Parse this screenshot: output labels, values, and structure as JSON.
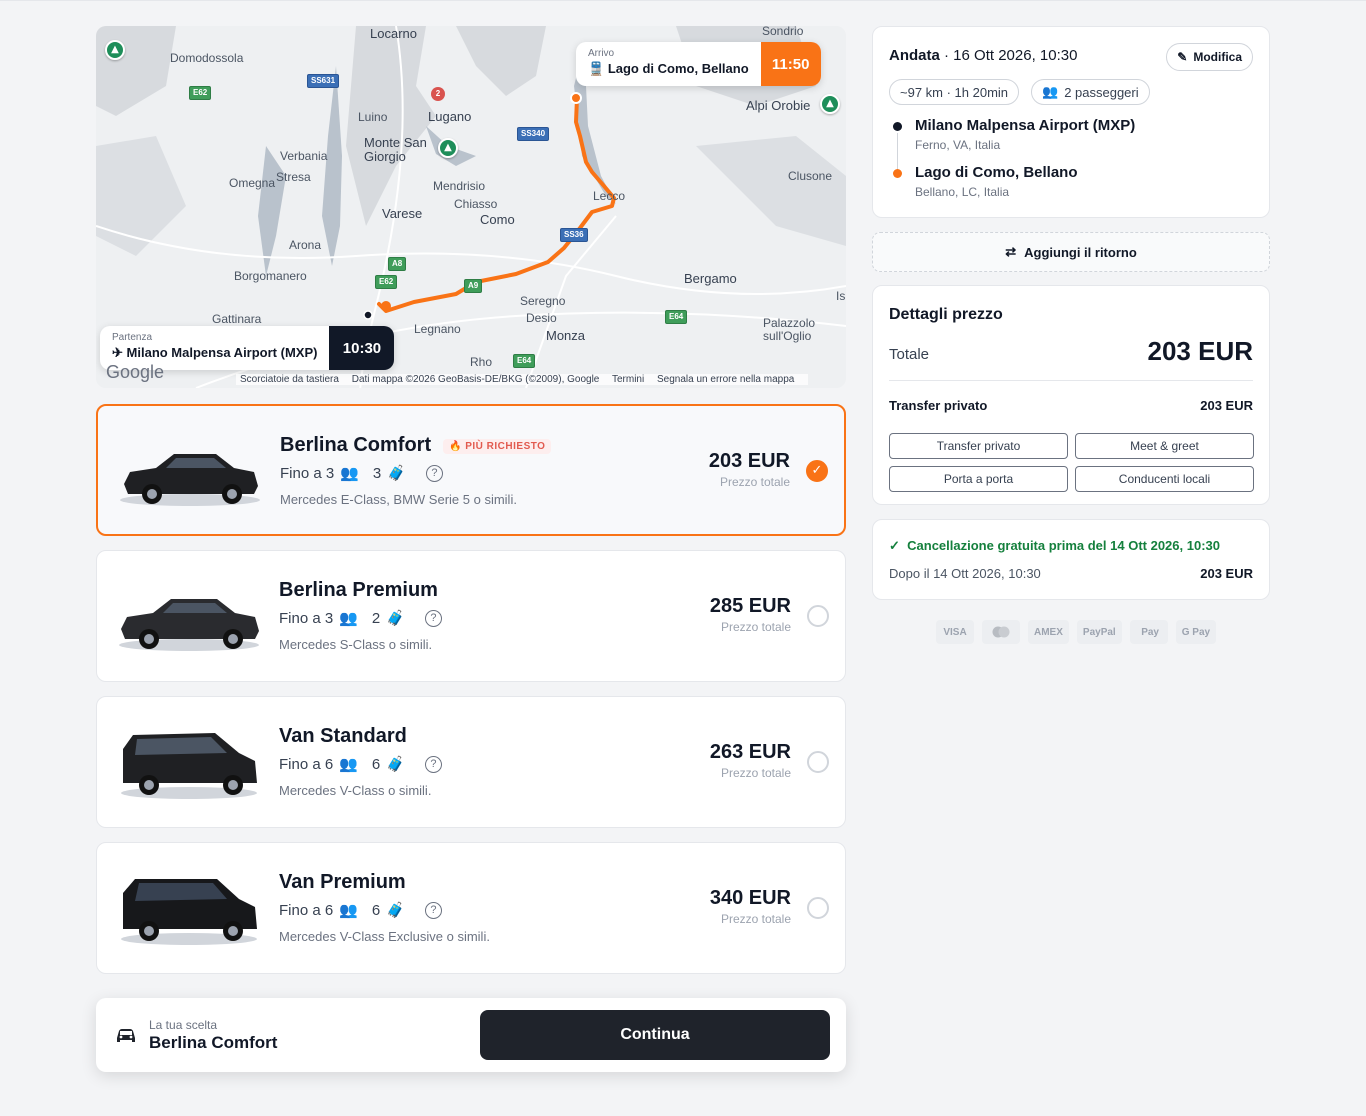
{
  "map": {
    "labels": [
      "Locarno",
      "Sondrio",
      "Domodossola",
      "Luino",
      "Lugano",
      "Alpi Orobie",
      "Monte San Giorgio",
      "Verbania",
      "Omegna",
      "Stresa",
      "Mendrisio",
      "Chiasso",
      "Varese",
      "Como",
      "Lecco",
      "Clusone",
      "Arona",
      "Borgomanero",
      "Gattinara",
      "Bergamo",
      "Seregno",
      "Desio",
      "Monza",
      "Legnano",
      "Rho",
      "Palazzolo sull'Oglio",
      "Is"
    ],
    "roads": [
      "SS631",
      "E62",
      "SS340",
      "SS36",
      "A8",
      "E62",
      "A9",
      "E64",
      "E64"
    ],
    "google": "Google",
    "footer": [
      "Scorciatoie da tastiera",
      "Dati mappa ©2026 GeoBasis-DE/BKG (©2009), Google",
      "Termini",
      "Segnala un errore nella mappa"
    ],
    "arrival": {
      "label": "Arrivo",
      "place": "Lago di Como, Bellano",
      "time": "11:50"
    },
    "departure": {
      "label": "Partenza",
      "place": "Milano Malpensa Airport (MXP)",
      "time": "10:30"
    }
  },
  "vehicles": [
    {
      "name": "Berlina Comfort",
      "badge": "PIÙ RICHIESTO",
      "up_to": "Fino a 3",
      "bags": "3",
      "models": "Mercedes E-Class, BMW Serie 5 o simili.",
      "price": "203 EUR",
      "price_label": "Prezzo totale"
    },
    {
      "name": "Berlina Premium",
      "up_to": "Fino a 3",
      "bags": "2",
      "models": "Mercedes S-Class o simili.",
      "price": "285 EUR",
      "price_label": "Prezzo totale"
    },
    {
      "name": "Van Standard",
      "up_to": "Fino a 6",
      "bags": "6",
      "models": "Mercedes V-Class o simili.",
      "price": "263 EUR",
      "price_label": "Prezzo totale"
    },
    {
      "name": "Van Premium",
      "up_to": "Fino a 6",
      "bags": "6",
      "models": "Mercedes V-Class Exclusive o simili.",
      "price": "340 EUR",
      "price_label": "Prezzo totale"
    }
  ],
  "selected_vehicle_index": 0,
  "choice": {
    "label": "La tua scelta",
    "value": "Berlina Comfort",
    "continue": "Continua"
  },
  "trip": {
    "direction": "Andata",
    "date": "· 16 Ott 2026, 10:30",
    "modify": "Modifica",
    "distance": "~97 km · 1h 20min",
    "passengers": "2 passeggeri",
    "from": {
      "name": "Milano Malpensa Airport (MXP)",
      "sub": "Ferno, VA, Italia"
    },
    "to": {
      "name": "Lago di Como, Bellano",
      "sub": "Bellano, LC, Italia"
    }
  },
  "return_btn": "Aggiungi il ritorno",
  "pricing": {
    "title": "Dettagli prezzo",
    "total_label": "Totale",
    "total": "203 EUR",
    "line_label": "Transfer privato",
    "line_value": "203 EUR",
    "features": [
      "Transfer privato",
      "Meet & greet",
      "Porta a porta",
      "Conducenti locali"
    ]
  },
  "cancellation": {
    "free": "Cancellazione gratuita prima del 14 Ott 2026, 10:30",
    "after_label": "Dopo il 14 Ott 2026, 10:30",
    "after_value": "203 EUR"
  },
  "payments": [
    "VISA",
    "AMEX",
    "PayPal",
    "Pay",
    "G Pay"
  ],
  "colors": {
    "accent": "#f97316",
    "dark": "#1f232b",
    "success": "#15803d"
  }
}
